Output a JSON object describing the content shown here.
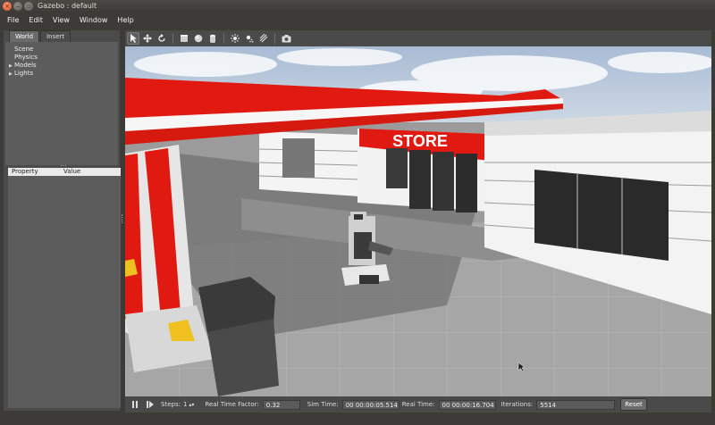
{
  "window": {
    "title": "Gazebo : default"
  },
  "menu": [
    "File",
    "Edit",
    "View",
    "Window",
    "Help"
  ],
  "left_panel": {
    "tabs": [
      "World",
      "Insert"
    ],
    "active_tab": "World",
    "tree": [
      {
        "label": "Scene",
        "expandable": false
      },
      {
        "label": "Physics",
        "expandable": false
      },
      {
        "label": "Models",
        "expandable": true
      },
      {
        "label": "Lights",
        "expandable": true
      }
    ],
    "property_header": {
      "property": "Property",
      "value": "Value"
    }
  },
  "toolbar": {
    "tools": [
      "select-arrow-icon",
      "translate-icon",
      "rotate-icon",
      "box-icon",
      "sphere-icon",
      "cylinder-icon",
      "point-light-icon",
      "spot-light-icon",
      "directional-light-icon",
      "screenshot-icon"
    ]
  },
  "scene": {
    "store_sign": "STORE",
    "colors": {
      "accent_red": "#e01a10",
      "sky": "#b7c6d8",
      "ground": "#a3a3a3"
    }
  },
  "status": {
    "steps_label": "Steps:",
    "steps_value": "1",
    "rtf_label": "Real Time Factor:",
    "rtf_value": "0.32",
    "sim_time_label": "Sim Time:",
    "sim_time_value": "00 00:00:05.514",
    "real_time_label": "Real Time:",
    "real_time_value": "00 00:00:16.704",
    "iterations_label": "Iterations:",
    "iterations_value": "5514",
    "reset_label": "Reset"
  }
}
